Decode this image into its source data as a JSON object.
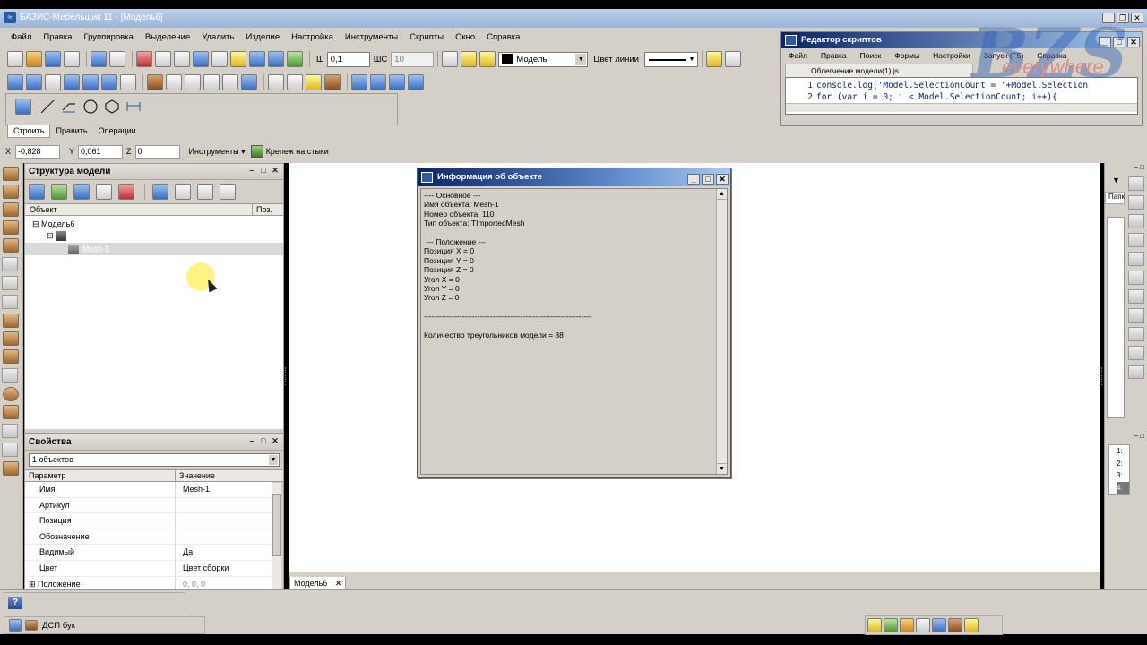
{
  "app": {
    "title": "БАЗИС-Мебельщик 11 - [Модель6]"
  },
  "menu": [
    "Файл",
    "Правка",
    "Группировка",
    "Выделение",
    "Удалить",
    "Изделие",
    "Настройка",
    "Инструменты",
    "Скрипты",
    "Окно",
    "Справка"
  ],
  "toolbar": {
    "sh_label": "Ш",
    "sh_value": "0,1",
    "shs_label": "ШС",
    "shs_value": "10",
    "layer": "Модель",
    "line_color_label": "Цвет линии"
  },
  "tabs": [
    "Строить",
    "Править",
    "Операции"
  ],
  "coords": {
    "x_label": "X",
    "x_value": "-0,828",
    "y_label": "Y",
    "y_value": "0,061",
    "z_label": "Z",
    "z_value": "0",
    "tools": "Инструменты",
    "krepezh": "Крепеж на стыки"
  },
  "structure": {
    "title": "Структура модели",
    "col_object": "Объект",
    "col_pos": "Поз.",
    "root": "Модель6",
    "child": "Mesh-1"
  },
  "properties": {
    "title": "Свойства",
    "selector": "1 объектов",
    "col_param": "Параметр",
    "col_value": "Значение",
    "rows": [
      {
        "k": "Имя",
        "v": "Mesh-1"
      },
      {
        "k": "Артикул",
        "v": ""
      },
      {
        "k": "Позиция",
        "v": ""
      },
      {
        "k": "Обозначение",
        "v": ""
      },
      {
        "k": "Видимый",
        "v": "Да"
      },
      {
        "k": "Цвет",
        "v": "Цвет сборки"
      },
      {
        "k": "Положение",
        "v": "0, 0, 0"
      }
    ]
  },
  "info_dialog": {
    "title": "Информация об объекте",
    "lines": [
      "---- Основное ---",
      "Имя объекта: Mesh-1",
      "Номер объекта: 110",
      "Тип объекта: TImportedMesh",
      "",
      " --- Положение ---",
      "Позиция X = 0",
      "Позиция Y = 0",
      "Позиция Z = 0",
      "Угол X = 0",
      "Угол Y = 0",
      "Угол Z = 0",
      "",
      "------------------------------------------------------------------",
      "",
      "Количество треугольников модели = 88"
    ]
  },
  "script_editor": {
    "title": "Редактор скриптов",
    "menu": [
      "Файл",
      "Правка",
      "Поиск",
      "Формы",
      "Настройки",
      "Запуск (F5)",
      "Справка"
    ],
    "tab": "Облегчение модели(1).js",
    "code": [
      {
        "n": "1",
        "text": "console.log('Model.SelectionCount = '+Model.Selection"
      },
      {
        "n": "2",
        "text": "for (var i = 0; i < Model.SelectionCount; i++){"
      }
    ]
  },
  "document_tab": "Модель6",
  "right_panel": {
    "label": "Папк",
    "label2": "Папк",
    "numbers": [
      "1:",
      "2:",
      "3:",
      "4:"
    ]
  },
  "status": {
    "material": "ДСП бук"
  },
  "watermark": {
    "text": "everywhere"
  }
}
